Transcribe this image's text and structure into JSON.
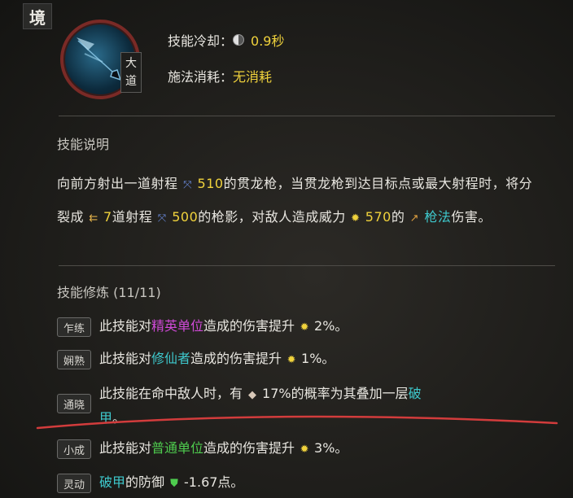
{
  "header": {
    "corner_label": "境"
  },
  "skill": {
    "tier_label_1": "大",
    "tier_label_2": "道",
    "cooldown_label": "技能冷却：",
    "cooldown_value": "0.9秒",
    "cost_label": "施法消耗：",
    "cost_value": "无消耗"
  },
  "description": {
    "title": "技能说明",
    "t1": "向前方射出一道射程",
    "range1": "510",
    "t2": "的贯龙枪，当贯龙枪到达目标点或最大射程时，将分裂成",
    "split_count": "7",
    "t3": "道射程",
    "range2": "500",
    "t4": "的枪影，对敌人造成威力",
    "power": "570",
    "t5": "的",
    "damage_type": "枪法",
    "t6": "伤害。"
  },
  "mastery": {
    "title": "技能修炼 (11/11)",
    "items": [
      {
        "badge": "乍练",
        "pre": "此技能对",
        "key": "精英单位",
        "post": "造成的伤害提升",
        "value": "2%。"
      },
      {
        "badge": "娴熟",
        "pre": "此技能对",
        "key": "修仙者",
        "post": "造成的伤害提升",
        "value": "1%。"
      },
      {
        "badge": "通晓",
        "pre": "此技能在命中敌人时，有",
        "value": "17%的概率为其叠加一层",
        "key": "破",
        "key2": "甲",
        "post": "。"
      },
      {
        "badge": "小成",
        "pre": "此技能对",
        "key": "普通单位",
        "post": "造成的伤害提升",
        "value": "3%。"
      },
      {
        "badge": "灵动",
        "key": "破甲",
        "pre": "的防御",
        "value": "-1.67点。"
      }
    ]
  },
  "colors": {
    "highlight_yellow": "#f0d23c",
    "highlight_cyan": "#3ec8cc",
    "highlight_green": "#4ecc4e",
    "highlight_magenta": "#d04ad8",
    "annotation_red": "#d23c3c"
  },
  "icons": [
    "cooldown-icon",
    "range-icon",
    "split-icon",
    "power-icon",
    "spear-icon",
    "pierce-icon",
    "shield-icon"
  ]
}
